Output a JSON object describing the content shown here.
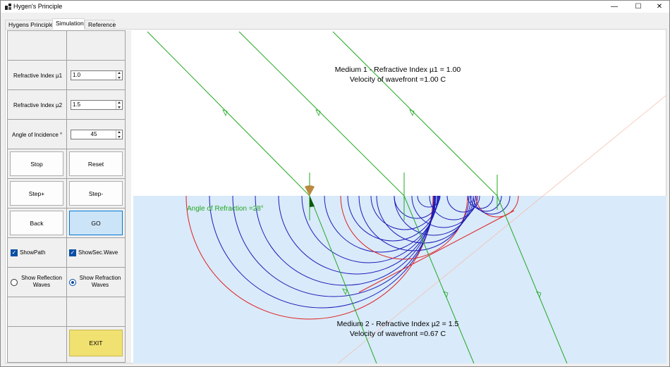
{
  "window": {
    "title": "Hygen's Principle",
    "minimize": "—",
    "maximize": "☐",
    "close": "✕"
  },
  "tabs": [
    {
      "label": "Hygens Principle"
    },
    {
      "label": "Simulation"
    },
    {
      "label": "Reference"
    }
  ],
  "controls": {
    "mu1_label": "Refractive Index µ1",
    "mu1_value": "1.0",
    "mu2_label": "Refractive Index µ2",
    "mu2_value": "1.5",
    "angle_label": "Angle of Incidence °",
    "angle_value": "45",
    "stop": "Stop",
    "reset": "Reset",
    "step_plus": "Step+",
    "step_minus": "Step-",
    "back": "Back",
    "go": "GO",
    "show_path": "ShowPath",
    "show_sec_wave": "ShowSec.Wave",
    "show_reflection": "Show Reflection\nWaves",
    "show_refraction": "Show Refraction\nWaves",
    "exit": "EXIT"
  },
  "simulation": {
    "medium1_line1": "Medium 1 - Refractive Index µ1 = 1.00",
    "medium1_line2": "Velocity of wavefront =1.00 C",
    "medium2_line1": "Medium 2 - Refractive Index µ2 = 1.5",
    "medium2_line2": "Velocity of wavefront =0.67 C",
    "refraction_label": "Angle of Refraction =28°",
    "colors": {
      "medium2": "#d9eafa",
      "ray": "#22a822",
      "wave": "#1c1cb8",
      "wave_edge": "#e02020",
      "normal": "#22a822",
      "reflected": "#f3c0b0"
    }
  }
}
